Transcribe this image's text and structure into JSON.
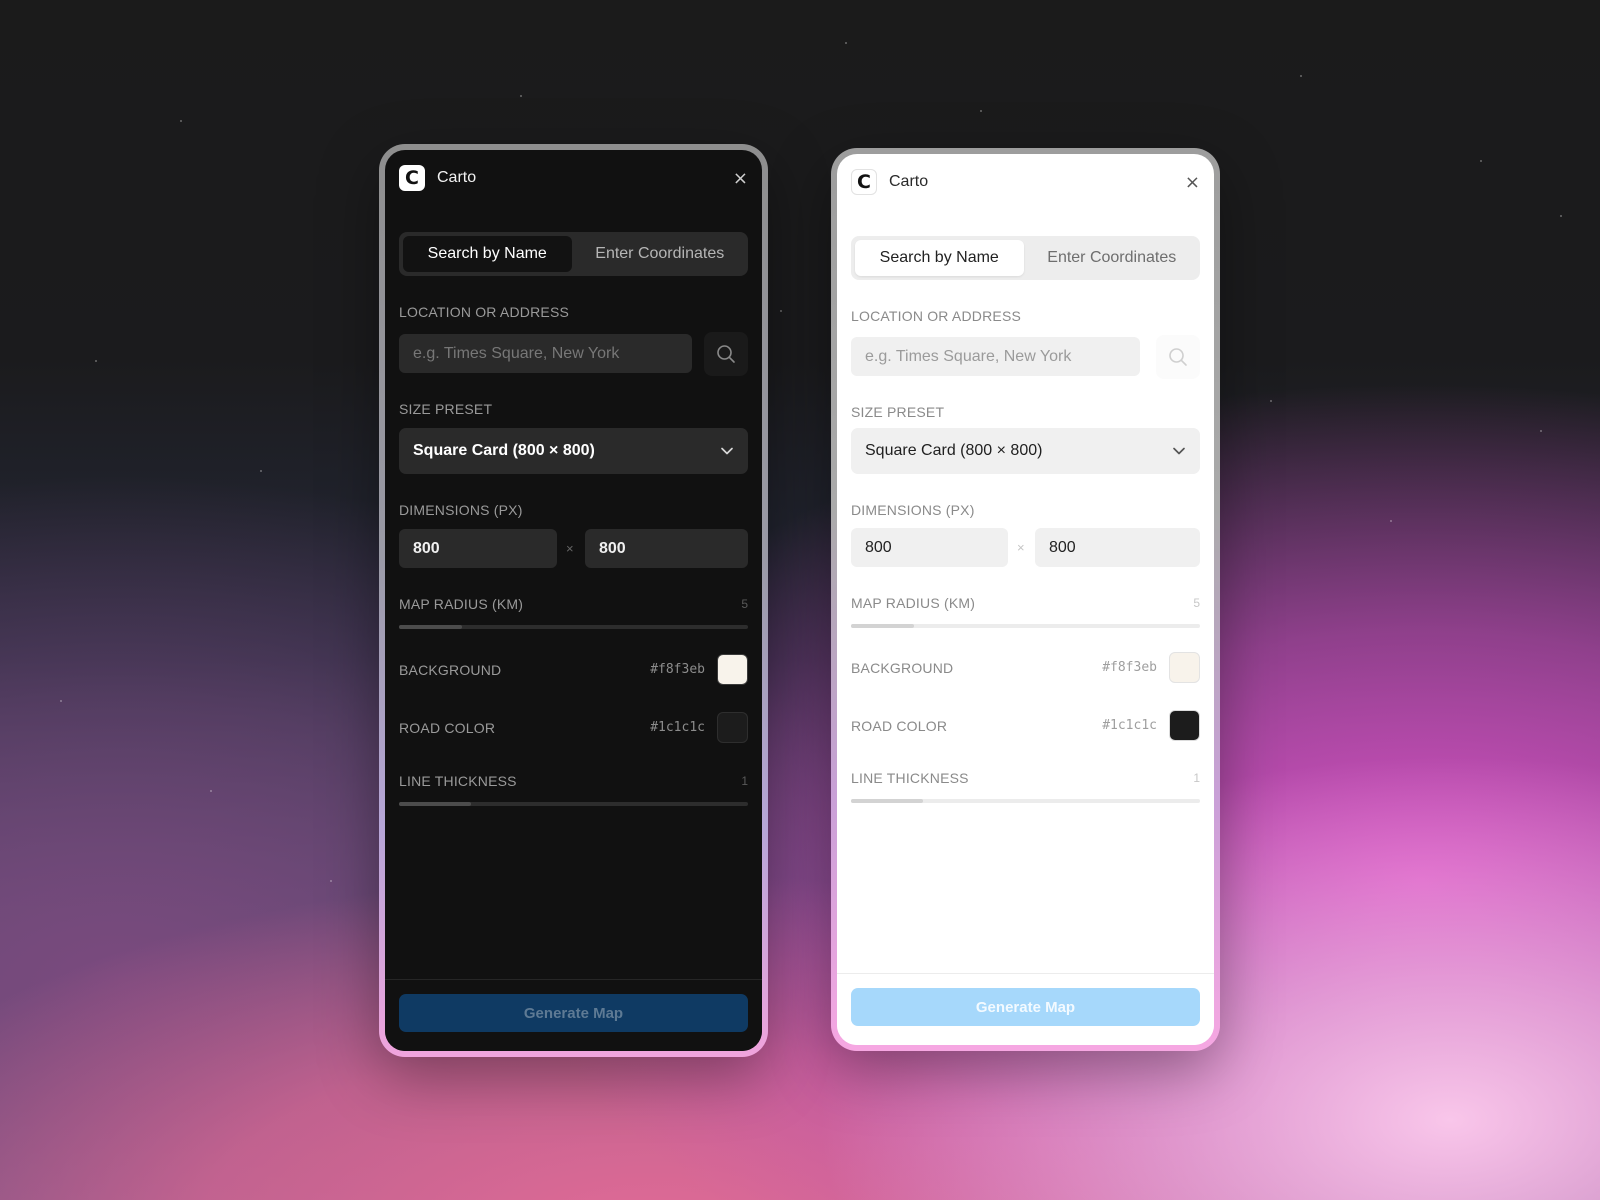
{
  "app": {
    "title": "Carto",
    "logo_letter": "C",
    "close_glyph": "×"
  },
  "tabs": [
    {
      "label": "Search by Name",
      "active": true
    },
    {
      "label": "Enter Coordinates",
      "active": false
    }
  ],
  "location": {
    "label": "LOCATION OR ADDRESS",
    "placeholder": "e.g. Times Square, New York",
    "value": "",
    "search_icon": "search-icon"
  },
  "size_preset": {
    "label": "SIZE PRESET",
    "selected": "Square Card (800 × 800)",
    "icon": "chevron-down-icon"
  },
  "dimensions": {
    "label": "DIMENSIONS (PX)",
    "width": "800",
    "height": "800",
    "separator": "×"
  },
  "map_radius": {
    "label": "MAP RADIUS (KM)",
    "value": "5",
    "fill_fraction": 0.18
  },
  "background": {
    "label": "BACKGROUND",
    "hex": "#f8f3eb",
    "color": "#f8f3eb"
  },
  "road_color": {
    "label": "ROAD COLOR",
    "hex": "#1c1c1c",
    "color": "#1c1c1c"
  },
  "line_thickness": {
    "label": "LINE THICKNESS",
    "value": "1",
    "fill_fraction": 0.205
  },
  "footer": {
    "generate_label": "Generate Map"
  },
  "themes": {
    "dark": {
      "accent": "#0f3a63",
      "panel": "#111111"
    },
    "light": {
      "accent": "#a6d8fb",
      "panel": "#ffffff"
    }
  }
}
